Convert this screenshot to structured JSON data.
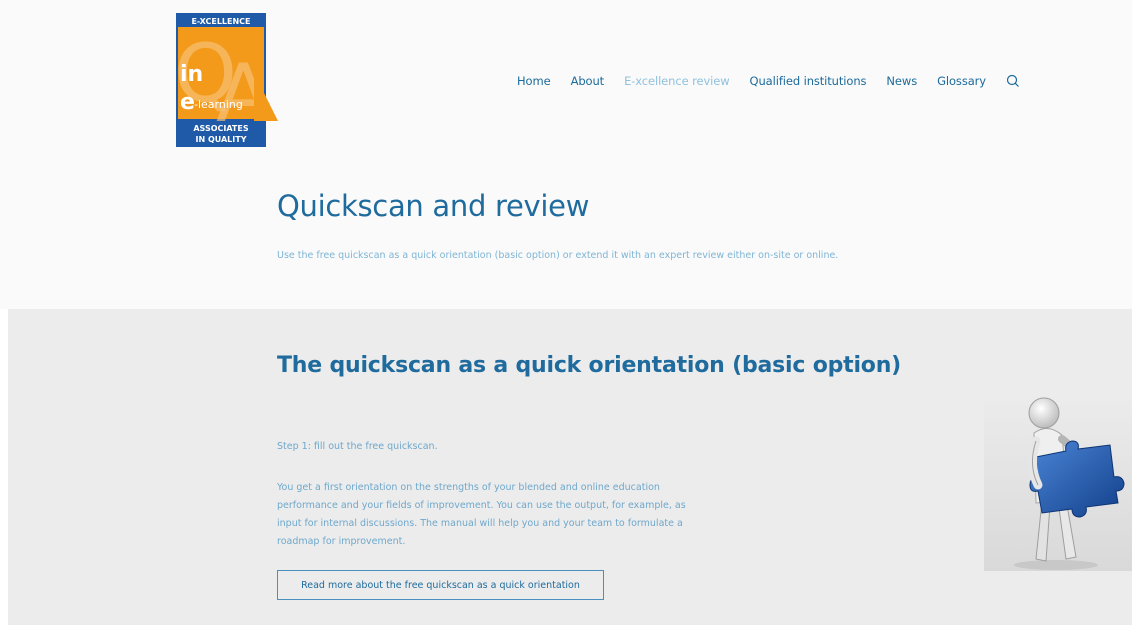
{
  "logo": {
    "top_text": "E-XCELLENCE",
    "in_text": "in",
    "e_text": "e",
    "learning_text": "-learning",
    "bottom_line1": "ASSOCIATES",
    "bottom_line2": "IN QUALITY",
    "letters": "QA",
    "colors": {
      "orange": "#f39a1b",
      "blue": "#1e5aa8",
      "white": "#ffffff"
    }
  },
  "nav": {
    "items": [
      {
        "label": "Home",
        "active": false
      },
      {
        "label": "About",
        "active": false
      },
      {
        "label": "E-xcellence review",
        "active": true
      },
      {
        "label": "Qualified institutions",
        "active": false
      },
      {
        "label": "News",
        "active": false
      },
      {
        "label": "Glossary",
        "active": false
      }
    ],
    "search_icon": "search-icon"
  },
  "header": {
    "title": "Quickscan and review",
    "subtitle": "Use the free quickscan as a quick orientation (basic option) or extend it with an expert review either on-site or online."
  },
  "section": {
    "title": "The quickscan as a quick orientation (basic option)",
    "step": "Step 1: fill out the free quickscan.",
    "body": "You get a first orientation on the strengths of your blended and online education performance and your fields of improvement. You can use the output, for example, as input for internal discussions. The manual will help you and your team to formulate a roadmap for improvement.",
    "button_label": "Read more about the free quickscan as a quick orientation",
    "illustration": "figure-holding-puzzle-piece-image"
  },
  "colors": {
    "accent": "#1f6b9d",
    "nav_active": "#8fc1de",
    "text_light": "#6ea8cc",
    "section_bg": "#ececec"
  }
}
